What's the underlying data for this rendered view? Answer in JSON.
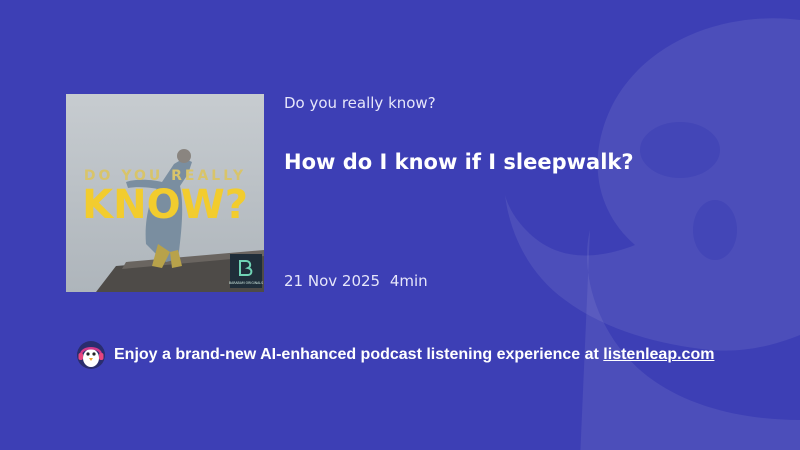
{
  "colors": {
    "background": "#3d3fb5",
    "cover_title": "#f2cc2e",
    "cover_subtitle": "#d8c46a"
  },
  "icons": {
    "background_logo": "podcast-mascot-watermark-icon",
    "promo_avatar": "penguin-headphones-icon",
    "cover_badge": "babbam-originals-logo-icon"
  },
  "cover": {
    "subtitle_text": "DO YOU REALLY",
    "title_text": "KNOW?",
    "badge_text": "BARABAM ORIGINALS"
  },
  "podcast": {
    "show_name": "Do you really know?",
    "episode_title": "How do I know if I sleepwalk?",
    "date": "21 Nov 2025",
    "duration": "4min"
  },
  "promo": {
    "text": "Enjoy a brand-new AI-enhanced podcast listening experience at ",
    "link": "listenleap.com"
  }
}
